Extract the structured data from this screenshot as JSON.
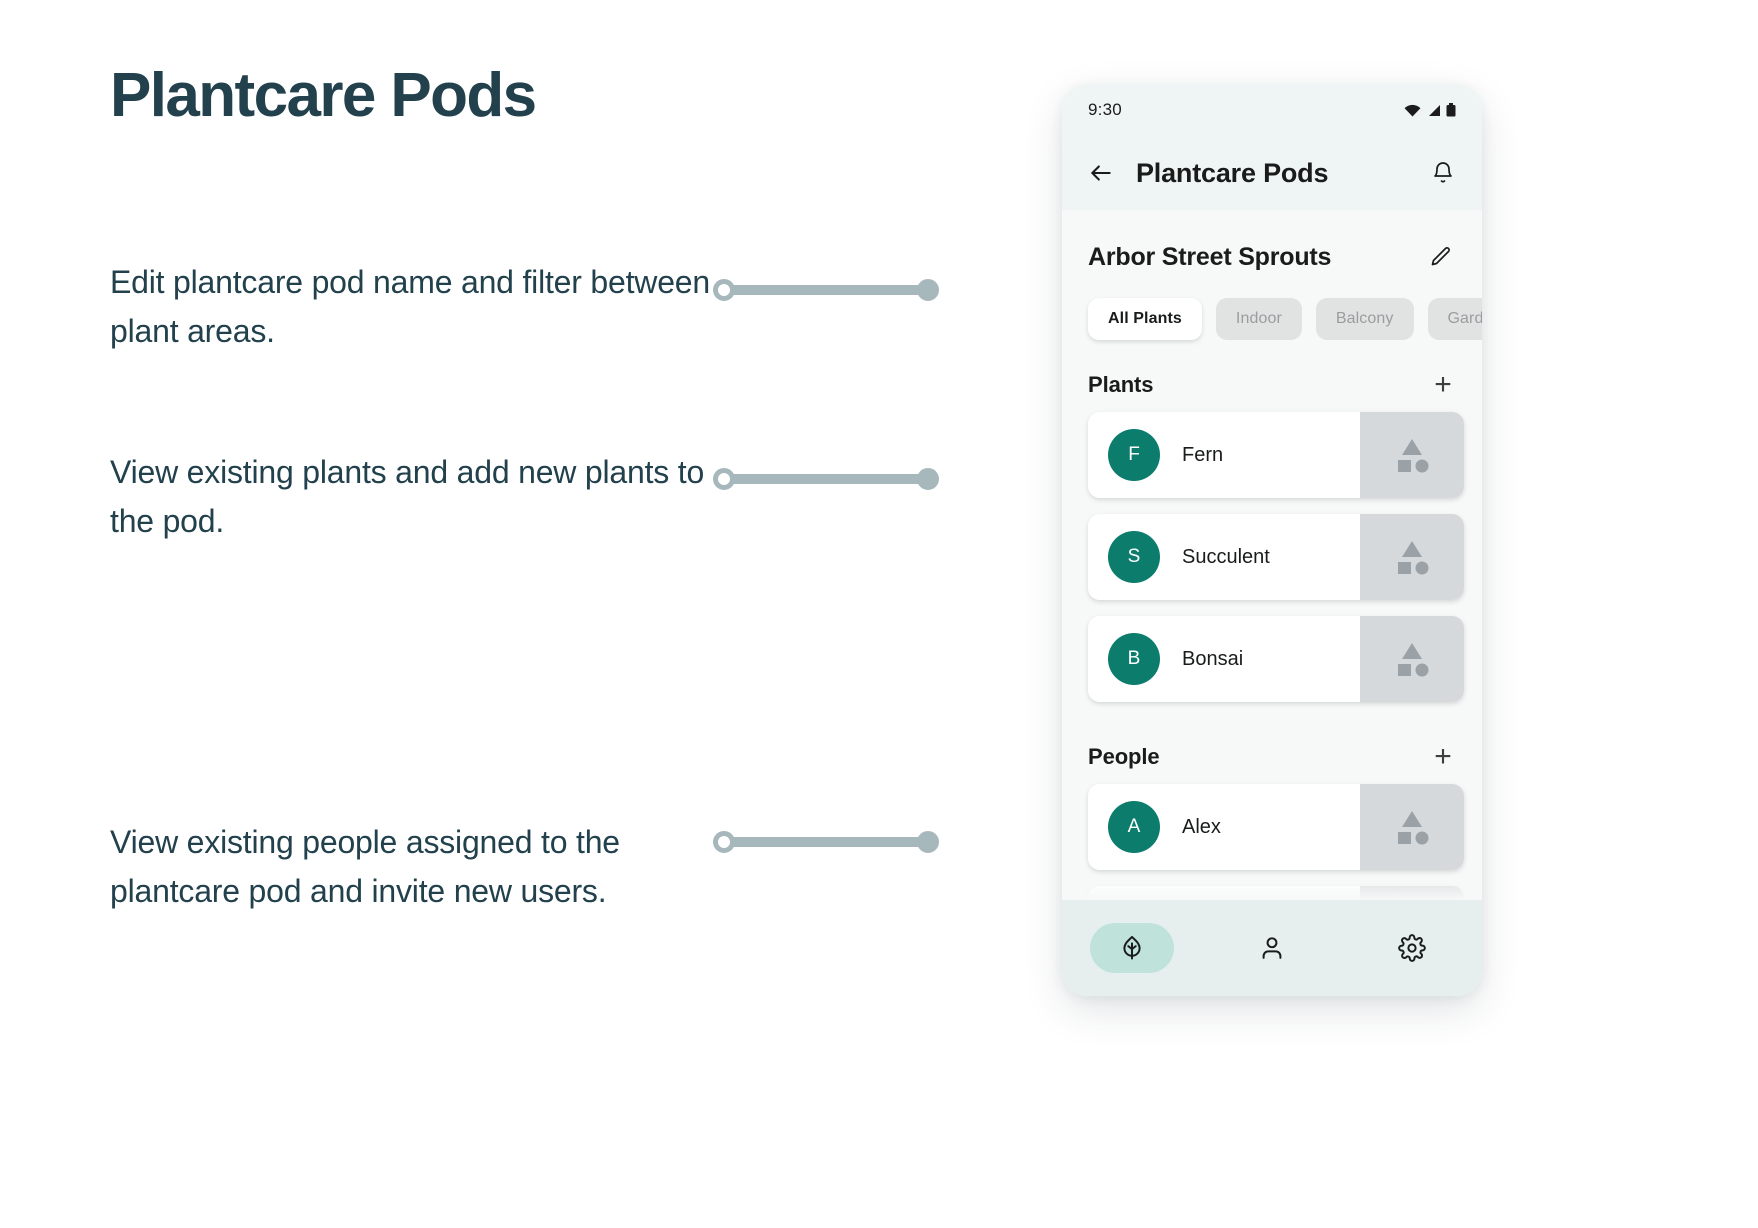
{
  "doc": {
    "title": "Plantcare Pods",
    "callouts": [
      "Edit plantcare pod name and filter between plant areas.",
      "View existing plants and add new plants to the pod.",
      "View existing people assigned to the plantcare pod and invite new users."
    ]
  },
  "colors": {
    "title_ink": "#22414C",
    "connector": "#A7B8BD",
    "accent_teal": "#0C7D6D",
    "appbar_bg": "#EFF5F4",
    "nav_bg": "#E6EFEE",
    "nav_active_pill": "#BFE2DA",
    "chip_unselected": "#E1E3E3",
    "thumb_gray": "#D6D9DB"
  },
  "phone": {
    "statusbar": {
      "time": "9:30",
      "icons": [
        "wifi-icon",
        "cell-signal-icon",
        "battery-icon"
      ]
    },
    "appbar": {
      "back_icon": "back-arrow-icon",
      "title": "Plantcare Pods",
      "notification_icon": "bell-icon"
    },
    "pod": {
      "name": "Arbor Street Sprouts",
      "edit_icon": "pencil-icon"
    },
    "filters": [
      {
        "label": "All Plants",
        "selected": true
      },
      {
        "label": "Indoor",
        "selected": false
      },
      {
        "label": "Balcony",
        "selected": false
      },
      {
        "label": "Garden",
        "selected": false
      }
    ],
    "sections": [
      {
        "title": "Plants",
        "add_label": "+",
        "items": [
          {
            "initial": "F",
            "name": "Fern"
          },
          {
            "initial": "S",
            "name": "Succulent"
          },
          {
            "initial": "B",
            "name": "Bonsai"
          }
        ]
      },
      {
        "title": "People",
        "add_label": "+",
        "items": [
          {
            "initial": "A",
            "name": "Alex"
          }
        ]
      }
    ],
    "bottom_nav": [
      {
        "icon": "leaf-icon",
        "active": true
      },
      {
        "icon": "person-icon",
        "active": false
      },
      {
        "icon": "gear-icon",
        "active": false
      }
    ]
  }
}
